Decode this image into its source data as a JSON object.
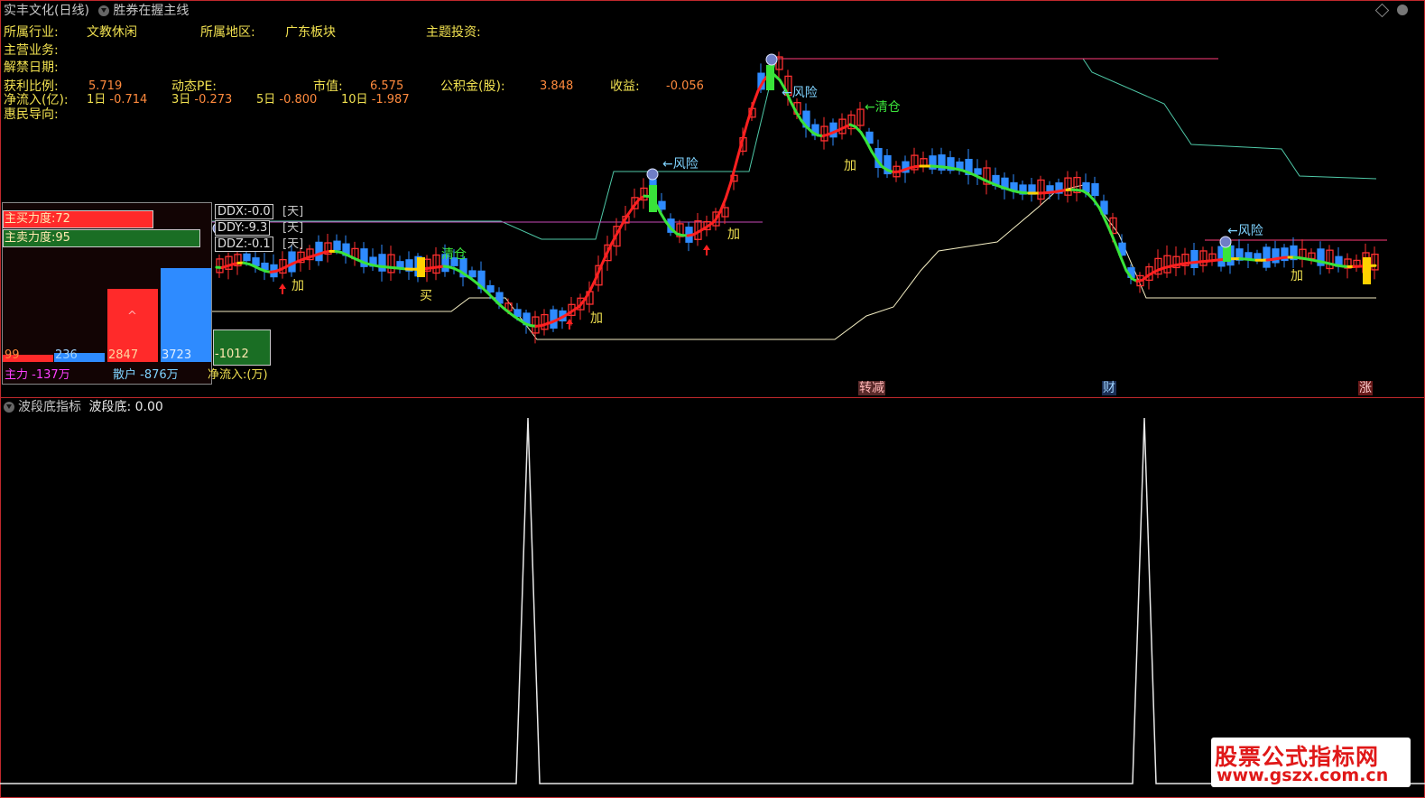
{
  "window": {
    "title": "实丰文化(日线)",
    "indicator_name": "胜券在握主线"
  },
  "info": {
    "industry_label": "所属行业:",
    "industry_value": "文教休闲",
    "region_label": "所属地区:",
    "region_value": "广东板块",
    "theme_label": "主题投资:",
    "business_label": "主营业务:",
    "unlock_label": "解禁日期:",
    "profit_ratio_label": "获利比例:",
    "profit_ratio_value": "5.719",
    "dyn_pe_label": "动态PE:",
    "mkt_cap_label": "市值:",
    "mkt_cap_value": "6.575",
    "reserve_label": "公积金(股):",
    "reserve_value": "3.848",
    "income_label": "收益:",
    "income_value": "-0.056",
    "netflow_label": "净流入(亿):",
    "d1_label": "1日",
    "d1_value": "-0.714",
    "d3_label": "3日",
    "d3_value": "-0.273",
    "d5_label": "5日",
    "d5_value": "-0.800",
    "d10_label": "10日",
    "d10_value": "-1.987",
    "policy_label": "惠民导向:"
  },
  "panel": {
    "buy_force": "主买力度:72",
    "sell_force": "主卖力度:95",
    "v1": "99",
    "v2": "236",
    "v3": "2847",
    "v4": "3723",
    "net": "-1012",
    "main_label": "主力 -137万",
    "retail_label": "散户 -876万",
    "netflow_unit": "净流入:(万)",
    "caret": "^"
  },
  "ddx": {
    "ddx": "DDX:-0.0",
    "ddy": "DDY:-9.3",
    "ddz": "DDZ:-0.1",
    "unit": "[天]"
  },
  "signals": {
    "risk": "←风险",
    "clear": "←清仓",
    "clear2": "清仓",
    "add": "加",
    "buy": "买"
  },
  "events": {
    "e1": "减",
    "e1pre": "转",
    "e2": "财",
    "e3": "涨"
  },
  "sub": {
    "title": "波段底指标",
    "value_label": "波段底: 0.00"
  },
  "watermark": {
    "line1": "股票公式指标网",
    "line2": "www.gszx.com.cn"
  },
  "colors": {
    "frame": "#c0282c",
    "up": "#ff3030",
    "down": "#2e8bff",
    "ma_green": "#39e339",
    "ma_yellow": "#ffd200",
    "ma_red": "#ff2020"
  }
}
